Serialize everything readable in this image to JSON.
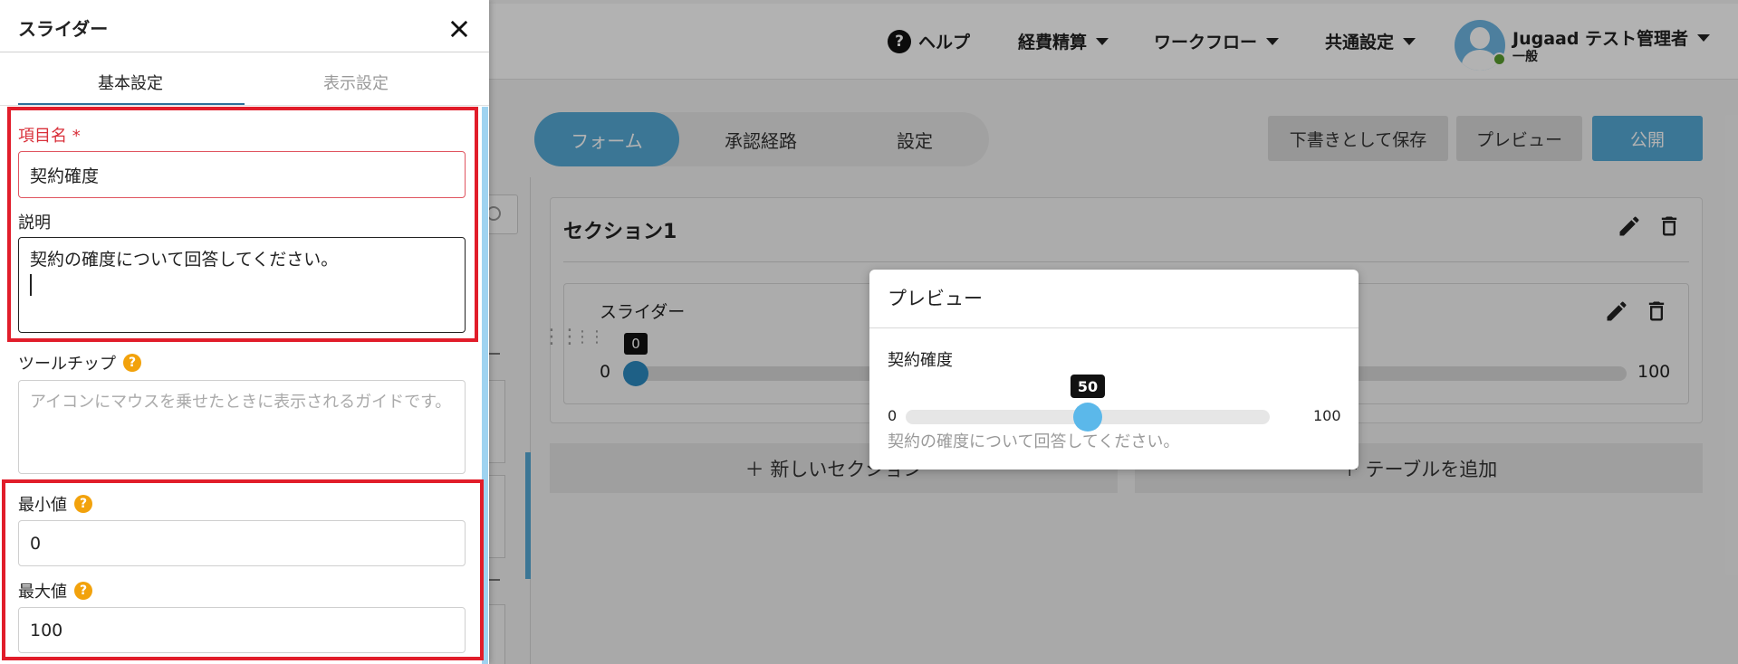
{
  "header": {
    "help": "ヘルプ",
    "menus": [
      "経費精算",
      "ワークフロー",
      "共通設定"
    ],
    "user_name": "Jugaad テスト管理者",
    "user_role": "一般"
  },
  "editor": {
    "tabs": [
      "フォーム",
      "承認経路",
      "設定"
    ],
    "active_tab": "フォーム",
    "save_draft": "下書きとして保存",
    "preview": "プレビュー",
    "publish": "公開",
    "section_title": "セクション1",
    "item_label": "スライダー",
    "slider_min": "0",
    "slider_max": "100",
    "slider_value": "0",
    "add_section": "＋ 新しいセクション",
    "add_table": "＋ テーブルを追加"
  },
  "panel": {
    "title": "スライダー",
    "tabs": [
      "基本設定",
      "表示設定"
    ],
    "active_tab": "基本設定",
    "item_name_label": "項目名 *",
    "item_name_value": "契約確度",
    "description_label": "説明",
    "description_value": "契約の確度について回答してください。",
    "tooltip_label": "ツールチップ",
    "tooltip_placeholder": "アイコンにマウスを乗せたときに表示されるガイドです。",
    "min_label": "最小値",
    "min_value": "0",
    "max_label": "最大値",
    "max_value": "100"
  },
  "preview_modal": {
    "title": "プレビュー",
    "label": "契約確度",
    "min": "0",
    "max": "100",
    "value": "50",
    "value_fraction": 0.5,
    "description": "契約の確度について回答してください。"
  },
  "colors": {
    "accent": "#55a9d6",
    "required": "#d9303a",
    "highlight_box": "#e11d2a",
    "help_icon": "#f2a20c",
    "slider_thumb": "#5bb8ea"
  }
}
